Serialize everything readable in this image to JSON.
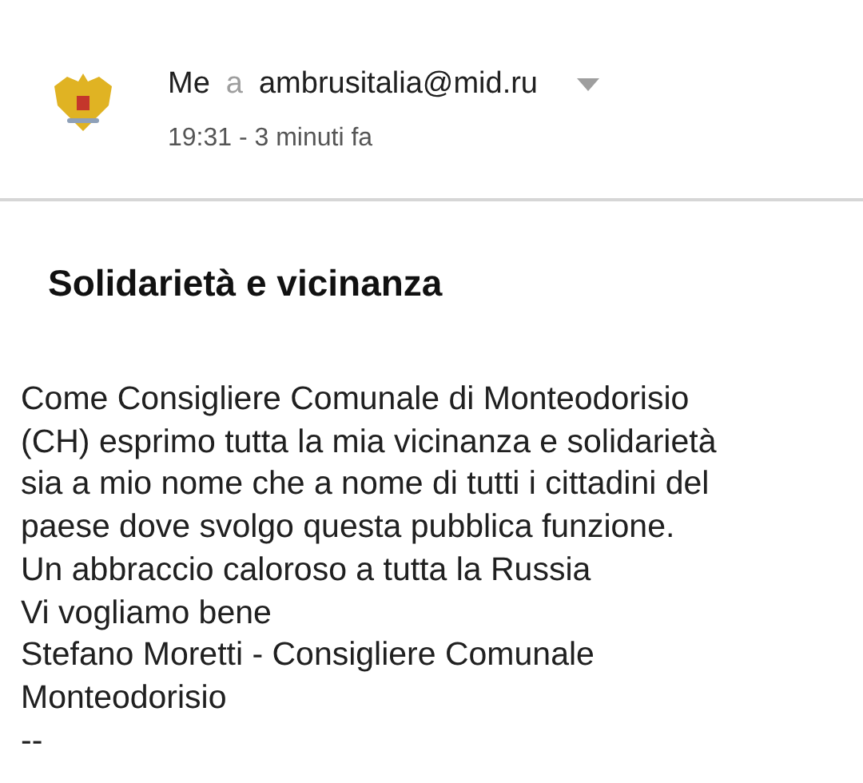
{
  "header": {
    "sender": "Me",
    "connector": "a",
    "recipient": "ambrusitalia@mid.ru",
    "time": "19:31 - 3 minuti fa"
  },
  "subject": "Solidarietà e vicinanza",
  "body_lines": [
    "Come Consigliere Comunale di Monteodorisio",
    "(CH) esprimo tutta la mia vicinanza e solidarietà",
    "sia a mio nome che a nome di tutti i cittadini del",
    "paese dove svolgo questa pubblica funzione.",
    "Un abbraccio caloroso a tutta la Russia",
    "Vi vogliamo bene",
    "Stefano Moretti - Consigliere Comunale",
    "Monteodorisio",
    "--"
  ]
}
